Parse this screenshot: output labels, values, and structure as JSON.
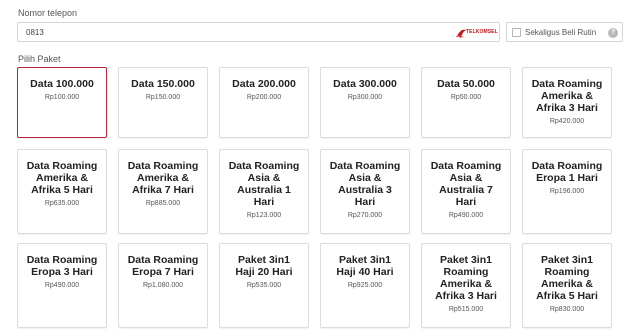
{
  "phone": {
    "label": "Nomor telepon",
    "value": "0813",
    "operator": "TELKOMSEL"
  },
  "rutin": {
    "label": "Sekaligus Beli Rutin",
    "checked": false
  },
  "packages": {
    "label": "Pilih Paket",
    "selected_index": 0,
    "items": [
      {
        "name": "Data 100.000",
        "price": "Rp100.000"
      },
      {
        "name": "Data 150.000",
        "price": "Rp150.000"
      },
      {
        "name": "Data 200.000",
        "price": "Rp200.000"
      },
      {
        "name": "Data 300.000",
        "price": "Rp300.000"
      },
      {
        "name": "Data 50.000",
        "price": "Rp50.000"
      },
      {
        "name": "Data Roaming\nAmerika &\nAfrika 3 Hari",
        "price": "Rp420.000"
      },
      {
        "name": "Data Roaming\nAmerika &\nAfrika 5 Hari",
        "price": "Rp635.000"
      },
      {
        "name": "Data Roaming\nAmerika &\nAfrika 7 Hari",
        "price": "Rp885.000"
      },
      {
        "name": "Data Roaming\nAsia &\nAustralia 1\nHari",
        "price": "Rp123.000"
      },
      {
        "name": "Data Roaming\nAsia &\nAustralia 3\nHari",
        "price": "Rp270.000"
      },
      {
        "name": "Data Roaming\nAsia &\nAustralia 7\nHari",
        "price": "Rp490.000"
      },
      {
        "name": "Data Roaming\nEropa 1 Hari",
        "price": "Rp196.000"
      },
      {
        "name": "Data Roaming\nEropa 3 Hari",
        "price": "Rp490.000"
      },
      {
        "name": "Data Roaming\nEropa 7 Hari",
        "price": "Rp1.080.000"
      },
      {
        "name": "Paket 3in1\nHaji 20 Hari",
        "price": "Rp535.000"
      },
      {
        "name": "Paket 3in1\nHaji 40 Hari",
        "price": "Rp925.000"
      },
      {
        "name": "Paket 3in1\nRoaming\nAmerika &\nAfrika 3 Hari",
        "price": "Rp515.000"
      },
      {
        "name": "Paket 3in1\nRoaming\nAmerika &\nAfrika 5 Hari",
        "price": "Rp830.000"
      }
    ]
  },
  "colors": {
    "selected_border": "#b8233a",
    "operator": "#c4161c"
  },
  "icons": {
    "operator_logo": "telkomsel-logo-icon",
    "help": "help-icon"
  }
}
